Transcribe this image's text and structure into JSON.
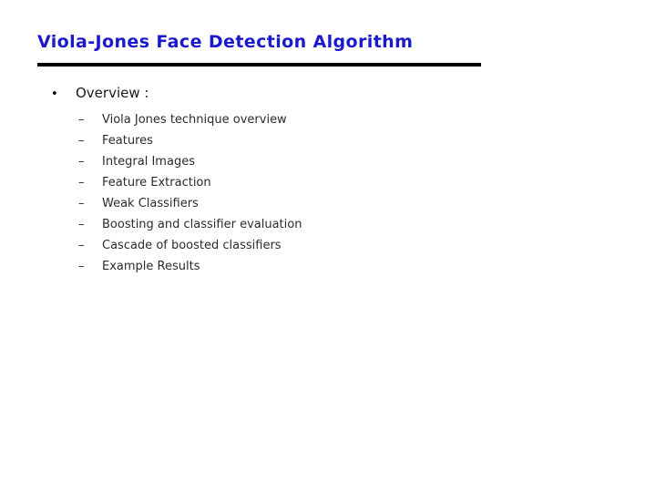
{
  "slide": {
    "title": "Viola-Jones Face Detection Algorithm",
    "title_color": "#1a1acc",
    "rule_color": "#000000",
    "background": "#ffffff",
    "body": {
      "level1": {
        "marker": "•",
        "label": "Overview :"
      },
      "level2_marker": "–",
      "items": [
        {
          "label": "Viola Jones technique overview"
        },
        {
          "label": "Features"
        },
        {
          "label": "Integral Images"
        },
        {
          "label": "Feature Extraction"
        },
        {
          "label": "Weak Classifiers"
        },
        {
          "label": "Boosting and classifier evaluation"
        },
        {
          "label": "Cascade of boosted classifiers"
        },
        {
          "label": "Example Results"
        }
      ]
    }
  }
}
